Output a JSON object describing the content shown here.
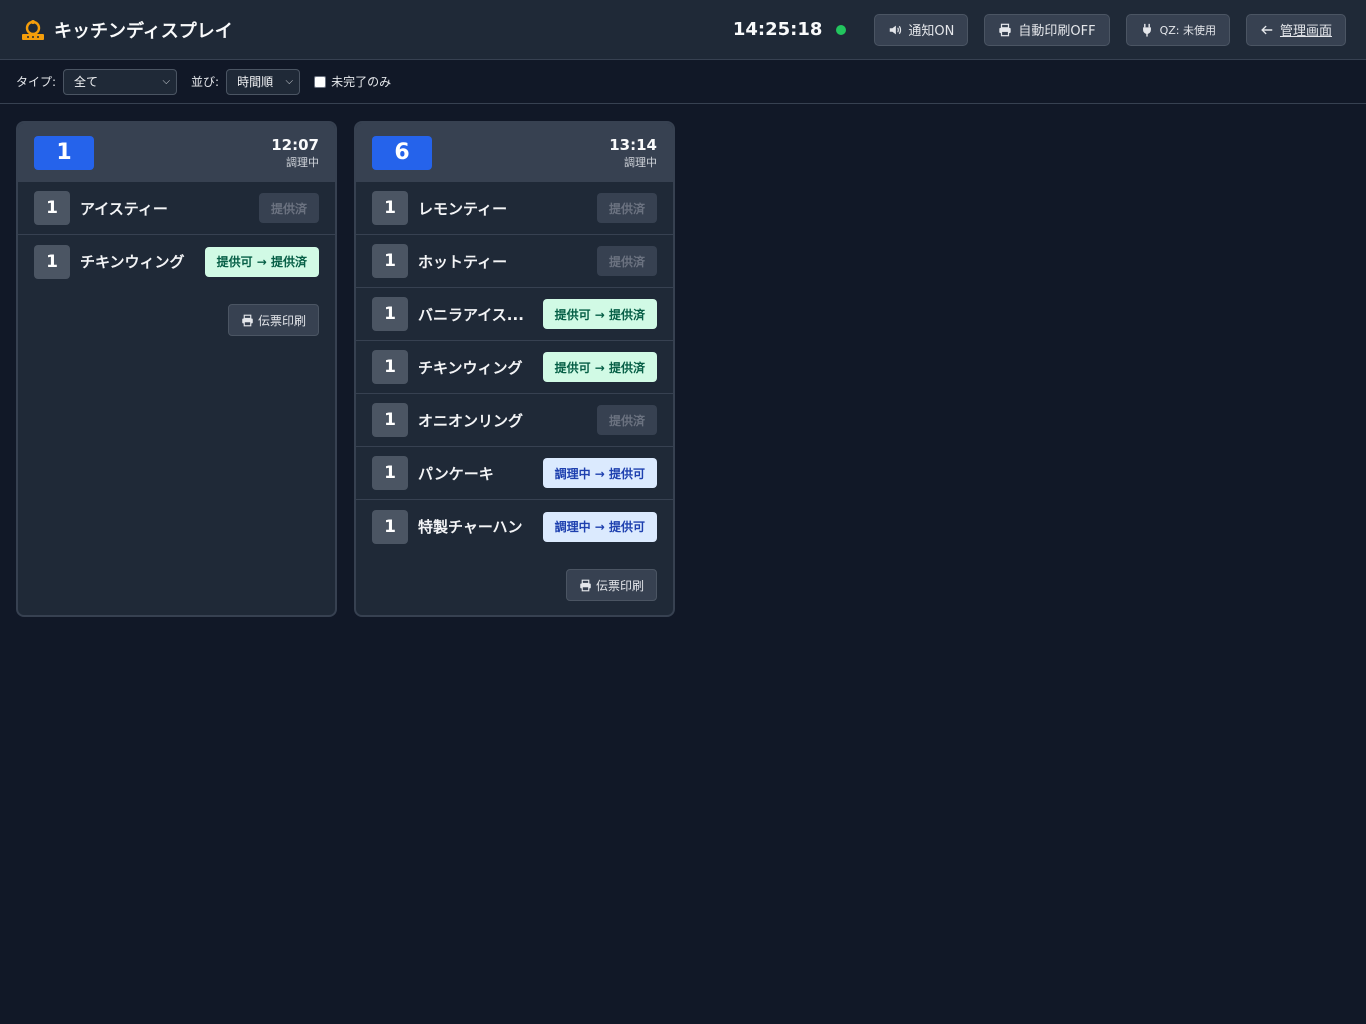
{
  "app": {
    "title": "キッチンディスプレイ",
    "clock": "14:25:18",
    "status_color": "#22c55e"
  },
  "header": {
    "notify_label": "通知ON",
    "autoprint_label": "自動印刷OFF",
    "qz_label": "QZ: 未使用",
    "manage_label": "管理画面"
  },
  "filters": {
    "type_label": "タイプ:",
    "type_value": "全て",
    "sort_label": "並び:",
    "sort_value": "時間順",
    "incomplete_label": "未完了のみ",
    "incomplete_checked": false
  },
  "orders": [
    {
      "table": "1",
      "time": "12:07",
      "status": "調理中",
      "print_label": "伝票印刷",
      "items": [
        {
          "qty": "1",
          "name": "アイスティー",
          "action": "提供済",
          "state": "done"
        },
        {
          "qty": "1",
          "name": "チキンウィング",
          "action": "提供可 → 提供済",
          "state": "ready"
        }
      ]
    },
    {
      "table": "6",
      "time": "13:14",
      "status": "調理中",
      "print_label": "伝票印刷",
      "items": [
        {
          "qty": "1",
          "name": "レモンティー",
          "action": "提供済",
          "state": "done"
        },
        {
          "qty": "1",
          "name": "ホットティー",
          "action": "提供済",
          "state": "done"
        },
        {
          "qty": "1",
          "name": "バニラアイス...",
          "action": "提供可 → 提供済",
          "state": "ready"
        },
        {
          "qty": "1",
          "name": "チキンウィング",
          "action": "提供可 → 提供済",
          "state": "ready"
        },
        {
          "qty": "1",
          "name": "オニオンリング",
          "action": "提供済",
          "state": "done"
        },
        {
          "qty": "1",
          "name": "パンケーキ",
          "action": "調理中 → 提供可",
          "state": "cooking"
        },
        {
          "qty": "1",
          "name": "特製チャーハン",
          "action": "調理中 → 提供可",
          "state": "cooking"
        }
      ]
    }
  ],
  "colors": {
    "background": "#111827",
    "panel": "#1f2937",
    "accent_blue": "#2563eb",
    "ready_bg": "#d1fae5",
    "cooking_bg": "#dbeafe",
    "brand_icon": "#f59e0b"
  },
  "icons": {
    "brand": "chef-hat-icon",
    "notify": "speaker-icon",
    "autoprint": "printer-icon",
    "qz": "plug-icon",
    "manage": "arrow-left-icon",
    "print": "printer-icon"
  }
}
